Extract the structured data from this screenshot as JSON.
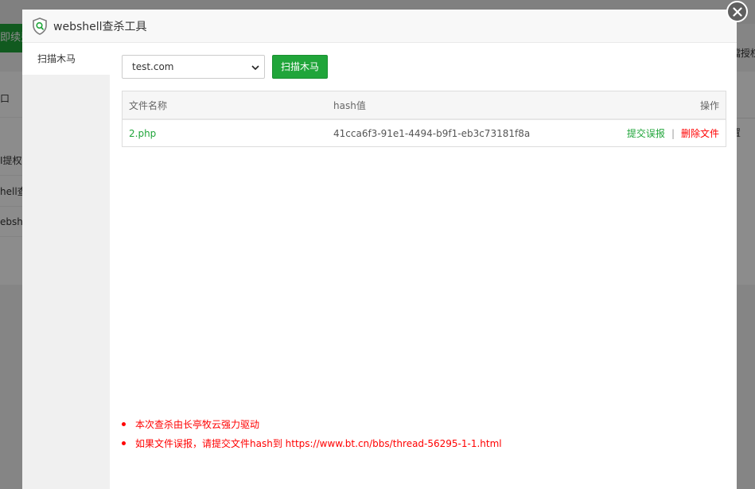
{
  "background": {
    "green_button_label": "即续费",
    "right_top_text": "擋授权",
    "col_header": "口",
    "right_col_text": "置",
    "rows": [
      "I提权",
      "hell查",
      "ebshe"
    ]
  },
  "modal": {
    "title": "webshell查杀工具",
    "icon": "shield-icon",
    "close_icon": "close-icon"
  },
  "sidebar": {
    "items": [
      {
        "label": "扫描木马"
      }
    ]
  },
  "toolbar": {
    "site_selected": "test.com",
    "scan_button_label": "扫描木马"
  },
  "table": {
    "headers": [
      "文件名称",
      "hash值",
      "操作"
    ],
    "rows": [
      {
        "filename": "2.php",
        "hash": "41cca6f3-91e1-4494-b9f1-eb3c73181f8a",
        "action_report": "提交误报",
        "action_separator": "|",
        "action_delete": "删除文件"
      }
    ]
  },
  "notes": [
    "本次查杀由长亭牧云强力驱动",
    "如果文件误报，请提交文件hash到 https://www.bt.cn/bbs/thread-56295-1-1.html"
  ],
  "colors": {
    "accent_green": "#20a53a",
    "danger_red": "#ff0000"
  }
}
